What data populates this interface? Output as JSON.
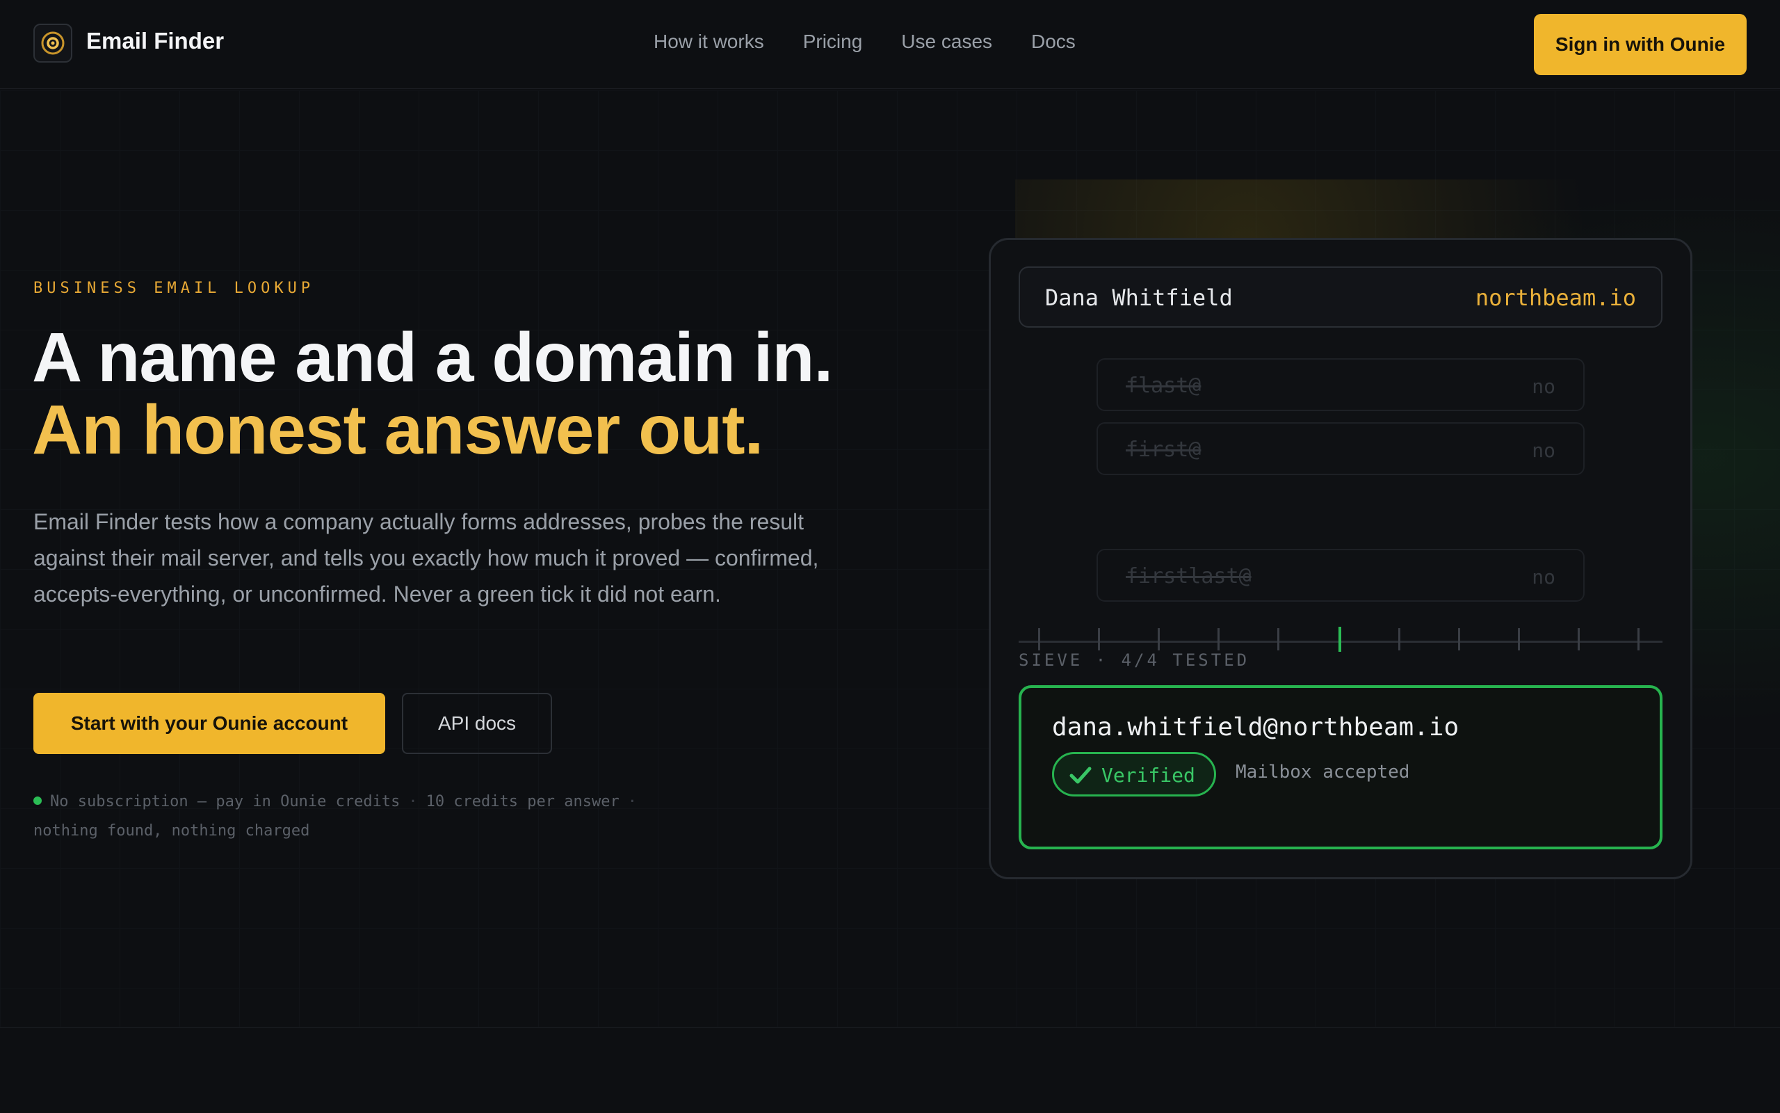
{
  "header": {
    "brand": "Email Finder",
    "nav": [
      "How it works",
      "Pricing",
      "Use cases",
      "Docs"
    ],
    "signin": "Sign in with Ounie"
  },
  "hero": {
    "kicker": "BUSINESS EMAIL LOOKUP",
    "title_line1": "A name and a domain in.",
    "title_line2": "An honest answer out.",
    "lead": "Email Finder tests how a company actually forms addresses, probes the result against their mail server, and tells you exactly how much it proved — confirmed, accepts-everything, or unconfirmed. Never a green tick it did not earn.",
    "primary_cta": "Start with your Ounie account",
    "secondary_cta": "API docs",
    "fine_1": "No subscription — pay in Ounie credits",
    "fine_2": "10 credits per answer",
    "fine_3": "nothing found, nothing charged"
  },
  "card": {
    "name": "Dana Whitfield",
    "domain": "northbeam.io",
    "candidates": [
      {
        "addr": "flast@",
        "result": "no"
      },
      {
        "addr": "first@",
        "result": "no"
      },
      {
        "addr": "firstlast@",
        "result": "no"
      }
    ],
    "sieve_label": "SIEVE · 4/4 TESTED",
    "result_email": "dana.whitfield@northbeam.io",
    "status": "Verified",
    "status_note": "Mailbox accepted"
  },
  "colors": {
    "accent": "#f0b62c",
    "success": "#27b34f",
    "background": "#0d0f12"
  }
}
